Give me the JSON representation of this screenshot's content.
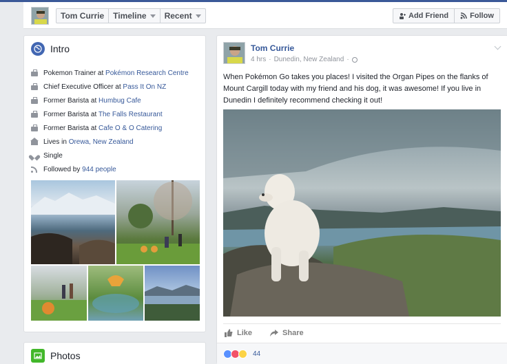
{
  "header": {
    "name_tab": "Tom Currie",
    "timeline_tab": "Timeline",
    "recent_tab": "Recent",
    "add_friend": "Add Friend",
    "follow": "Follow"
  },
  "intro": {
    "title": "Intro",
    "items": [
      {
        "icon": "briefcase-icon",
        "prefix": "Pokemon Trainer at ",
        "link": "Pokémon Research Centre"
      },
      {
        "icon": "briefcase-icon",
        "prefix": "Chief Executive Officer at ",
        "link": "Pass It On NZ"
      },
      {
        "icon": "briefcase-icon",
        "prefix": "Former Barista at ",
        "link": "Humbug Cafe"
      },
      {
        "icon": "briefcase-icon",
        "prefix": "Former Barista at ",
        "link": "The Falls Restaurant"
      },
      {
        "icon": "briefcase-icon",
        "prefix": "Former Barista at ",
        "link": "Cafe O & O Catering"
      },
      {
        "icon": "home-icon",
        "prefix": "Lives in ",
        "link": "Orewa, New Zealand"
      },
      {
        "icon": "heart-icon",
        "prefix": "Single",
        "link": ""
      },
      {
        "icon": "rss-icon",
        "prefix": "Followed by ",
        "link": "944 people"
      }
    ]
  },
  "photos": {
    "title": "Photos"
  },
  "post": {
    "author": "Tom Currie",
    "time": "4 hrs",
    "separator": "·",
    "location": "Dunedin, New Zealand",
    "text": "When Pokémon Go takes you places! I visited the Organ Pipes on the flanks of Mount Cargill today with my friend and his dog, it was awesome! If you live in Dunedin I definitely recommend checking it out!",
    "like": "Like",
    "share": "Share",
    "reaction_count": "44"
  },
  "colors": {
    "brand": "#3b5998",
    "link": "#365899",
    "background": "#e9ebee"
  }
}
